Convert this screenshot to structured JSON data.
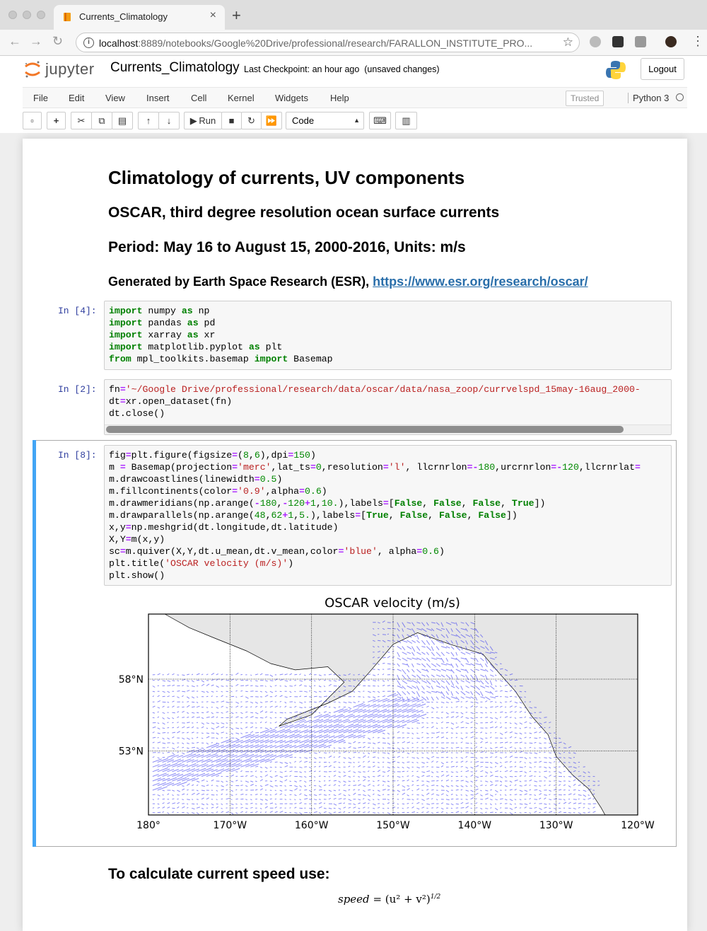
{
  "browser": {
    "tab_title": "Currents_Climatology",
    "new_tab": "+",
    "url_host": "localhost",
    "url_rest": ":8889/notebooks/Google%20Drive/professional/research/FARALLON_INSTITUTE_PRO...",
    "close": "×"
  },
  "jupyter": {
    "logo_text": "jupyter",
    "notebook_name": "Currents_Climatology",
    "checkpoint": "Last Checkpoint: an hour ago",
    "unsaved": "(unsaved changes)",
    "logout": "Logout"
  },
  "menu": [
    "File",
    "Edit",
    "View",
    "Insert",
    "Cell",
    "Kernel",
    "Widgets",
    "Help"
  ],
  "trusted": "Trusted",
  "kernel_name": "Python 3",
  "toolbar": {
    "run_label": "Run",
    "cell_type": "Code"
  },
  "markdown": {
    "h1": "Climatology of currents, UV components",
    "h2a": "OSCAR, third degree resolution ocean surface currents",
    "h2b": "Period: May 16 to August 15, 2000-2016, Units: m/s",
    "h3_prefix": "Generated by Earth Space Research (ESR), ",
    "h3_link": "https://www.esr.org/research/oscar/",
    "bottom_heading": "To calculate current speed use:"
  },
  "cells": {
    "c1_prompt": "In [4]:",
    "c2_prompt": "In [2]:",
    "c3_prompt": "In [8]:"
  },
  "chart_data": {
    "type": "quiver-map",
    "title": "OSCAR velocity (m/s)",
    "x_tick_labels": [
      "180°",
      "170°W",
      "160°W",
      "150°W",
      "140°W",
      "130°W",
      "120°W"
    ],
    "y_tick_labels": [
      "58°N",
      "53°N"
    ],
    "lon_range": [
      -180,
      -120
    ],
    "lat_range": [
      48,
      62
    ],
    "vector_color": "#3a3af0",
    "land_color": "#e6e6e6",
    "grid": "dotted"
  },
  "math": {
    "lhs": "speed",
    "rhs": "= (u² + v²)",
    "exponent": "1/2"
  }
}
